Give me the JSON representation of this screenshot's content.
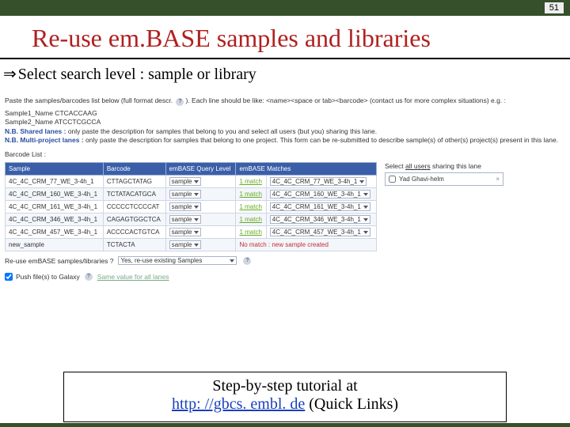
{
  "page_number": "51",
  "title": "Re-use em.BASE samples and libraries",
  "subtitle_prefix": "Select",
  "subtitle_rest": " search level : sample or library",
  "panel": {
    "instr_before": "Paste the samples/barcodes list below (full format descr. ",
    "instr_after": "). Each line should be like: <name><space or tab><barcode> (contact us for more complex situations) e.g. :",
    "example1": "Sample1_Name CTCACCAAG",
    "example2": "Sample2_Name ATCCTCGCCA",
    "nb_shared_label": "N.B. Shared lanes :",
    "nb_shared_text": " only paste the description for samples that belong to you and select all users (but you) sharing this lane.",
    "nb_multi_label": "N.B. Multi-project lanes :",
    "nb_multi_text": " only paste the description for samples that belong to one project. This form can be re-submitted to describe sample(s) of other(s) project(s) present in this lane.",
    "barcode_list_label": "Barcode List :",
    "headers": {
      "sample": "Sample",
      "barcode": "Barcode",
      "query": "emBASE Query Level",
      "matches": "emBASE Matches"
    },
    "rows": [
      {
        "sample": "4C_4C_CRM_77_WE_3-4h_1",
        "barcode": "CTTAGCTATAG",
        "query": "sample",
        "match": "1 match",
        "matchval": "4C_4C_CRM_77_WE_3-4h_1"
      },
      {
        "sample": "4C_4C_CRM_160_WE_3-4h_1",
        "barcode": "TCTATACATGCA",
        "query": "sample",
        "match": "1 match",
        "matchval": "4C_4C_CRM_160_WE_3-4h_1"
      },
      {
        "sample": "4C_4C_CRM_161_WE_3-4h_1",
        "barcode": "CCCCCTCCCCAT",
        "query": "sample",
        "match": "1 match",
        "matchval": "4C_4C_CRM_161_WE_3-4h_1"
      },
      {
        "sample": "4C_4C_CRM_346_WE_3-4h_1",
        "barcode": "CAGAGTGGCTCA",
        "query": "sample",
        "match": "1 match",
        "matchval": "4C_4C_CRM_346_WE_3-4h_1"
      },
      {
        "sample": "4C_4C_CRM_457_WE_3-4h_1",
        "barcode": "ACCCCACTGTCA",
        "query": "sample",
        "match": "1 match",
        "matchval": "4C_4C_CRM_457_WE_3-4h_1"
      },
      {
        "sample": "new_sample",
        "barcode": "TCTACTA",
        "query": "sample",
        "match": "No match : new sample created",
        "matchval": ""
      }
    ],
    "select_users_label_a": "Select ",
    "select_users_label_b": "all users",
    "select_users_label_c": " sharing this lane",
    "user_option": "Yad Ghavi-helm",
    "reuse_label": "Re-use emBASE samples/libraries ?",
    "reuse_value": "Yes, re-use existing Samples",
    "push_label": "Push file(s) to Galaxy",
    "same_value": "Same value for all lanes",
    "help_q": "?"
  },
  "footer": {
    "line1": "Step-by-step tutorial at",
    "link": "http: //gbcs. embl. de",
    "line2_rest": " (Quick Links)"
  }
}
